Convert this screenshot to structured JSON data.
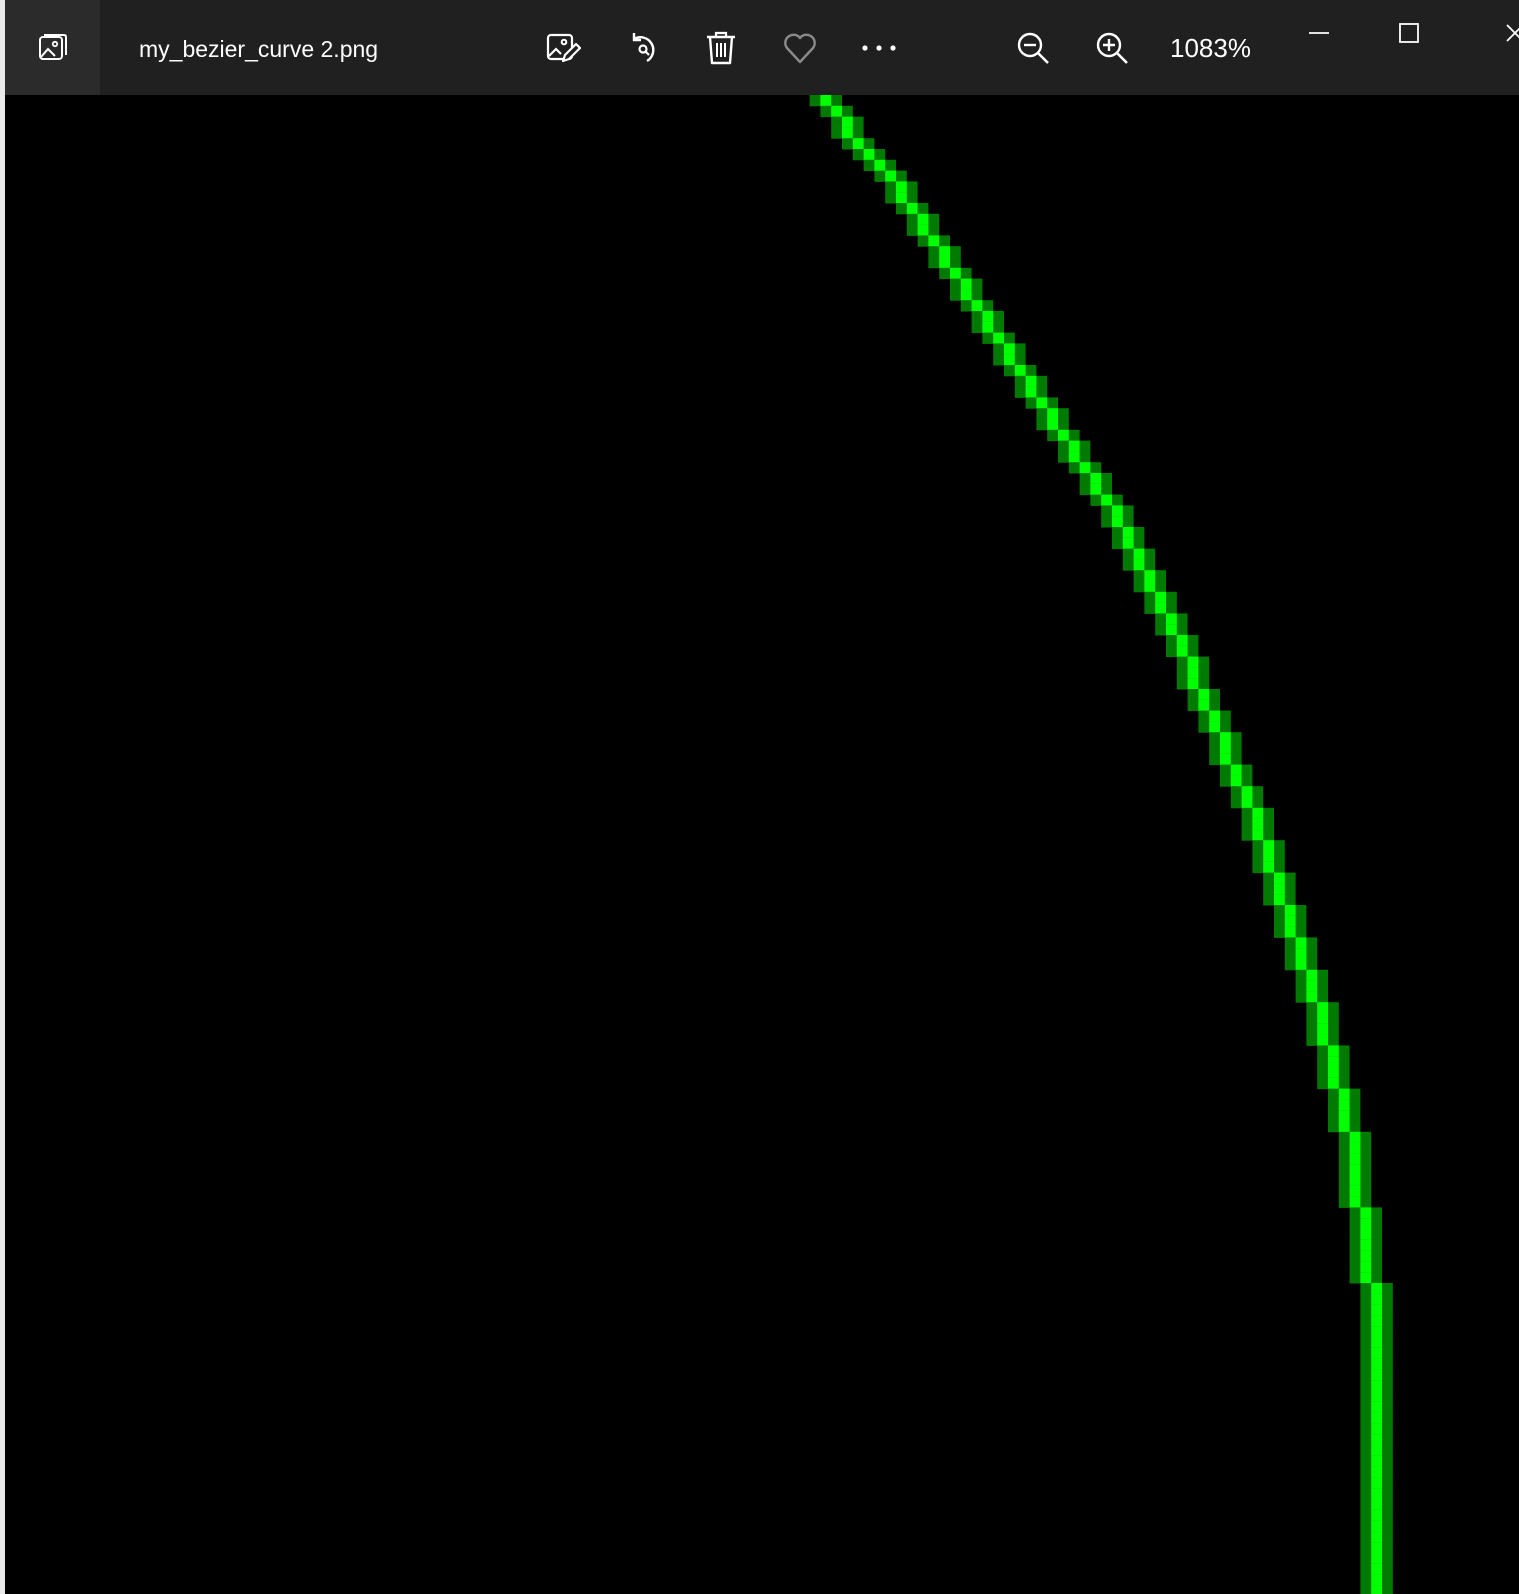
{
  "window": {
    "file_name": "my_bezier_curve 2.png",
    "zoom_level": "1083%"
  },
  "toolbar": {
    "icons": [
      "edit-image-icon",
      "rotate-icon",
      "delete-icon",
      "favorite-icon",
      "more-icon"
    ],
    "zoom_out_icon": "zoom-out-icon",
    "zoom_in_icon": "zoom-in-icon"
  },
  "window_controls": [
    "minimize-icon",
    "maximize-icon",
    "close-icon"
  ],
  "image": {
    "background_color": "#000000",
    "curve_color": "#00ff00",
    "curve_edge_color": "#007a00"
  }
}
